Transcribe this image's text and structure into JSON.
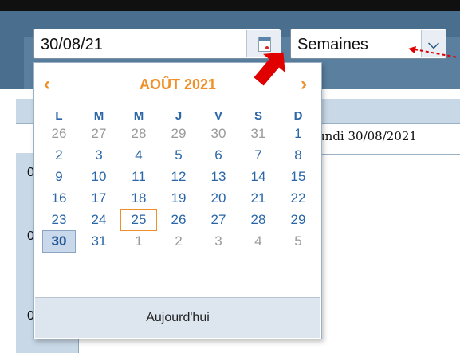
{
  "date_input": {
    "value": "30/08/21"
  },
  "period_select": {
    "value": "Semaines"
  },
  "schedule": {
    "day_label": "undi 30/08/2021",
    "time_labels": [
      "0",
      "0",
      "0"
    ]
  },
  "calendar": {
    "month_label": "AOÛT 2021",
    "weekdays": [
      "L",
      "M",
      "M",
      "J",
      "V",
      "S",
      "D"
    ],
    "weeks": [
      [
        "26",
        "27",
        "28",
        "29",
        "30",
        "31",
        "1"
      ],
      [
        "2",
        "3",
        "4",
        "5",
        "6",
        "7",
        "8"
      ],
      [
        "9",
        "10",
        "11",
        "12",
        "13",
        "14",
        "15"
      ],
      [
        "16",
        "17",
        "18",
        "19",
        "20",
        "21",
        "22"
      ],
      [
        "23",
        "24",
        "25",
        "26",
        "27",
        "28",
        "29"
      ],
      [
        "30",
        "31",
        "1",
        "2",
        "3",
        "4",
        "5"
      ]
    ],
    "today_label": "Aujourd'hui"
  },
  "colors": {
    "accent": "#f0902a",
    "link": "#2a66a8",
    "toolbar": "#4a6f8e",
    "annotation": "#e00000"
  }
}
